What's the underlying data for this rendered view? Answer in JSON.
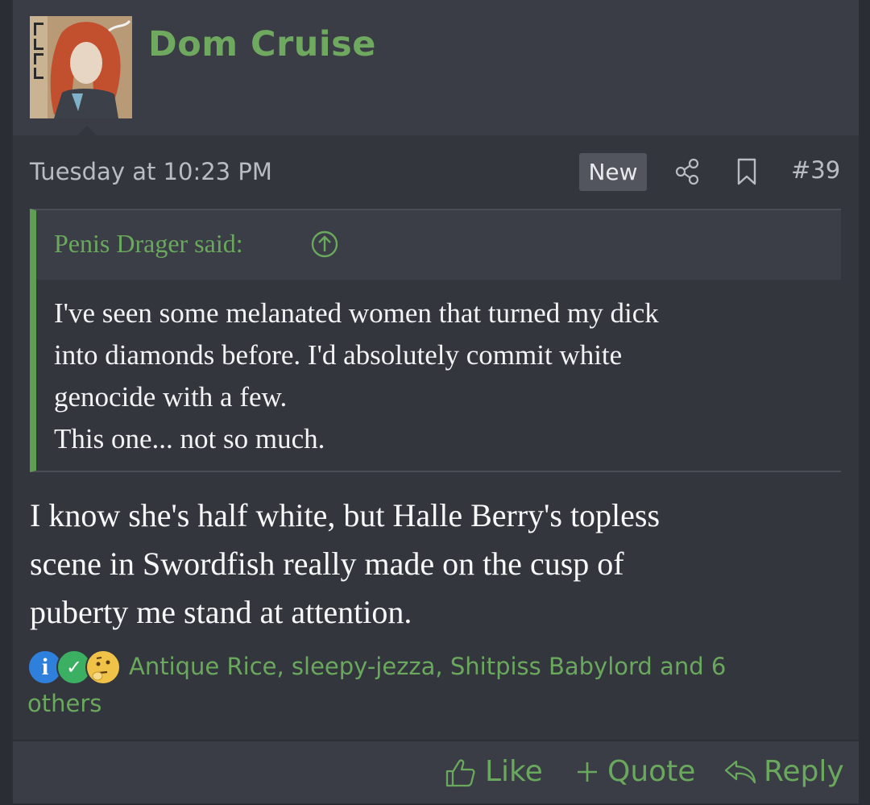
{
  "post": {
    "username": "Dom Cruise",
    "avatar_label": "FLCL",
    "date": "Tuesday at 10:23 PM",
    "badge": "New",
    "post_number": "#39",
    "icons": {
      "share": "share-icon",
      "bookmark": "bookmark-icon"
    }
  },
  "quote": {
    "author": "Penis Drager said:",
    "lines": [
      "I've seen some melanated women that turned my dick",
      "into diamonds before. I'd absolutely commit white",
      "genocide with a few.",
      "This one... not so much."
    ]
  },
  "message": {
    "lines": [
      "I know she's half white, but Halle Berry's topless",
      "scene in Swordfish really made on the cusp of",
      "puberty me stand at attention."
    ]
  },
  "reactions": {
    "icons": [
      "info-icon",
      "check-icon",
      "thinking-emoji-icon"
    ],
    "summary": "Antique Rice, sleepy-jezza, Shitpiss Babylord and 6 others"
  },
  "actions": {
    "like": "Like",
    "quote": "Quote",
    "reply": "Reply"
  },
  "colors": {
    "accent_green": "#6aa95d",
    "background": "#33363d",
    "header": "#3a3d45"
  }
}
